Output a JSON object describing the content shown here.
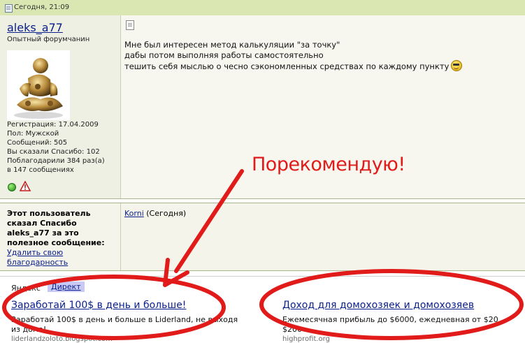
{
  "header": {
    "date": "Сегодня, 21:09"
  },
  "post": {
    "username": "aleks_a77",
    "user_title": "Опытный форумчанин",
    "user_info": "Регистрация: 17.04.2009\nПол: Мужской\nСообщений: 505\nВы сказали Спасибо: 102\nПоблагодарили 384 раз(а)\nв 147 сообщениях",
    "message_lines": [
      "Мне был интересен метод калькуляции \"за точку\"",
      "дабы потом выполняя работы самостоятельно",
      "тешить себя мыслью о чесно сэкономленных средствах по каждому пункту"
    ]
  },
  "thanks": {
    "label": "Этот пользователь сказал Спасибо aleks_a77 за это полезное сообщение:",
    "remove_link": "Удалить свою благодарность",
    "user": "Korni",
    "when": "(Сегодня)"
  },
  "ads": {
    "yandex_label": "Яндекс",
    "direct_label": "Директ",
    "ad1": {
      "title": "Заработай 100$ в день и больше!",
      "desc_line1": "Заработай 100$ в день и больше в Liderland, не выходя",
      "desc_line2": "из дома!",
      "host": "liderlandzoloto.blogspot.com"
    },
    "ad2": {
      "title": "Доход для домохозяек и домохозяев",
      "desc_line1": "Ежемесячная прибыль до $6000, ежедневная от $20",
      "desc_line2": "$200",
      "host": "highprofit.org"
    }
  },
  "annotation": {
    "text": "Порекомендую!",
    "color": "#e11a1a"
  }
}
